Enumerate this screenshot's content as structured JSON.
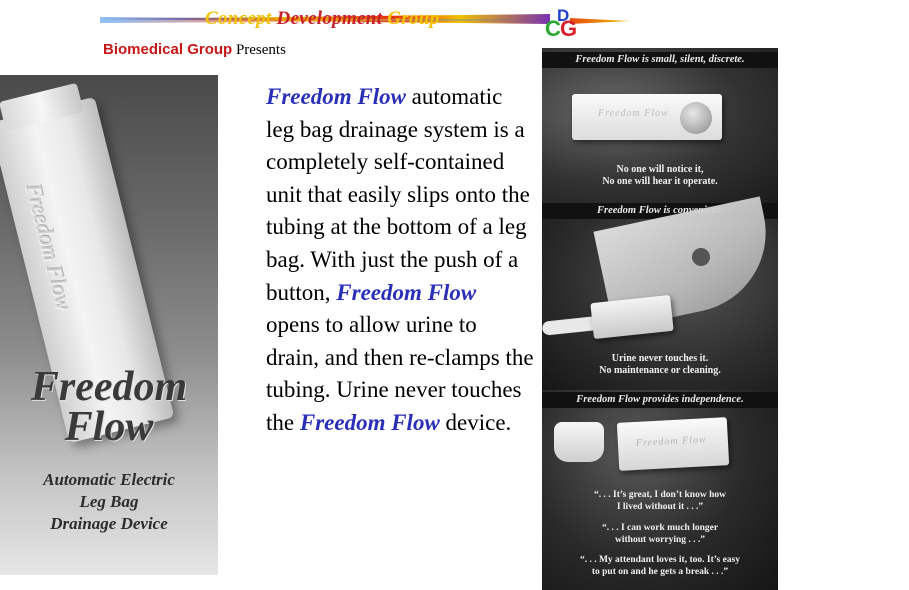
{
  "header": {
    "banner_title_part1": "Concept ",
    "banner_title_part2": "Development",
    "banner_title_part3": " Group",
    "logo_letters": {
      "c": "C",
      "d": "D",
      "g": "G"
    },
    "presenter": "Biomedical Group",
    "presents": "Presents"
  },
  "product_photo": {
    "device_engraving": "Freedom Flow",
    "title_line1": "Freedom",
    "title_line2": "Flow",
    "subtitle_line1": "Automatic Electric",
    "subtitle_line2": "Leg Bag",
    "subtitle_line3": "Drainage Device"
  },
  "body": {
    "brand1": "Freedom Flow",
    "text1": " automatic leg bag drainage system is a completely self-contained unit that easily slips onto the tubing at the bottom of a leg bag. With just the push of a button, ",
    "brand2": "Freedom Flow",
    "text2": " opens to allow urine to drain, and then re-clamps the tubing. Urine never touches the ",
    "brand3": "Freedom Flow",
    "text3": " device."
  },
  "brochure": {
    "section1": {
      "header": "Freedom Flow is small, silent, discrete.",
      "device_label": "Freedom  Flow",
      "caption_line1": "No one will notice it,",
      "caption_line2": "No one will hear it operate."
    },
    "section2": {
      "header": "Freedom Flow is convenient.",
      "caption_line1": "Urine never touches it.",
      "caption_line2": "No maintenance or cleaning."
    },
    "section3": {
      "header": "Freedom Flow provides independence.",
      "device_label": "Freedom  Flow",
      "quote1_line1": "“. . . It’s great, I don’t know how",
      "quote1_line2": "I lived without it . . .”",
      "quote2_line1": "“. . . I can work much longer",
      "quote2_line2": "without worrying . . .”",
      "quote3_line1": "“. . . My attendant loves it, too. It’s easy",
      "quote3_line2": "to put on and he gets a break . . .”"
    }
  },
  "colors": {
    "brand_blue": "#2b2fb8",
    "biomedical_red": "#c81818",
    "banner_gold": "#f2c200",
    "banner_red": "#c8202a"
  }
}
